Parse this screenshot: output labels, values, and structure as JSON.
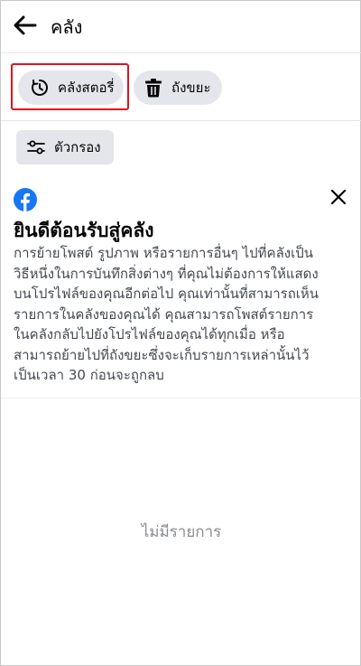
{
  "header": {
    "title": "คลัง"
  },
  "filters": {
    "archive_label": "คลังสตอรี่",
    "trash_label": "ถังขยะ",
    "filter_label": "ตัวกรอง"
  },
  "welcome": {
    "title": "ยินดีต้อนรับสู่คลัง",
    "body_lines": [
      "การย้ายโพสต์ รูปภาพ หรือรายการอื่นๆ ไปที่คลังเป็น",
      "วิธีหนึ่งในการบันทึกสิ่งต่างๆ ที่คุณไม่ต้องการให้แสดง",
      "บนโปรไฟล์ของคุณอีกต่อไป คุณเท่านั้นที่สามารถเห็น",
      "รายการในคลังของคุณได้ คุณสามารถโพสต์รายการ",
      "ในคลังกลับไปยังโปรไฟล์ของคุณได้ทุกเมื่อ หรือ",
      "สามารถย้ายไปที่ถังขยะซึ่งจะเก็บรายการเหล่านั้นไว้",
      "เป็นเวลา 30 ก่อนจะถูกลบ"
    ]
  },
  "empty_state": {
    "text": "ไม่มีรายการ"
  },
  "icons": {
    "back": "arrow-left-icon",
    "archive": "clock-archive-icon",
    "trash": "trash-icon",
    "filter": "filter-sliders-icon",
    "brand": "facebook-logo",
    "close": "close-icon"
  },
  "colors": {
    "highlight": "#e0121e",
    "chip_bg": "#e4e6eb",
    "facebook_blue": "#1877f2",
    "body_text": "#444950",
    "muted_text": "#8a8d91"
  }
}
